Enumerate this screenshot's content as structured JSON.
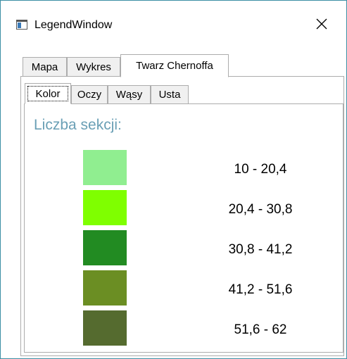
{
  "window": {
    "title": "LegendWindow",
    "close_symbol": "✕"
  },
  "outer_tabs": [
    {
      "label": "Mapa",
      "selected": false
    },
    {
      "label": "Wykres",
      "selected": false
    },
    {
      "label": "Twarz Chernoffa",
      "selected": true
    }
  ],
  "inner_tabs": [
    {
      "label": "Kolor",
      "selected": true
    },
    {
      "label": "Oczy",
      "selected": false
    },
    {
      "label": "Wąsy",
      "selected": false
    },
    {
      "label": "Usta",
      "selected": false
    }
  ],
  "legend": {
    "label": "Liczba sekcji:",
    "items": [
      {
        "color": "#90ee90",
        "range": "10 - 20,4"
      },
      {
        "color": "#7fff00",
        "range": "20,4 - 30,8"
      },
      {
        "color": "#228b22",
        "range": "30,8 - 41,2"
      },
      {
        "color": "#6b8e23",
        "range": "41,2 - 51,6"
      },
      {
        "color": "#556b2f",
        "range": "51,6 - 62"
      }
    ]
  }
}
